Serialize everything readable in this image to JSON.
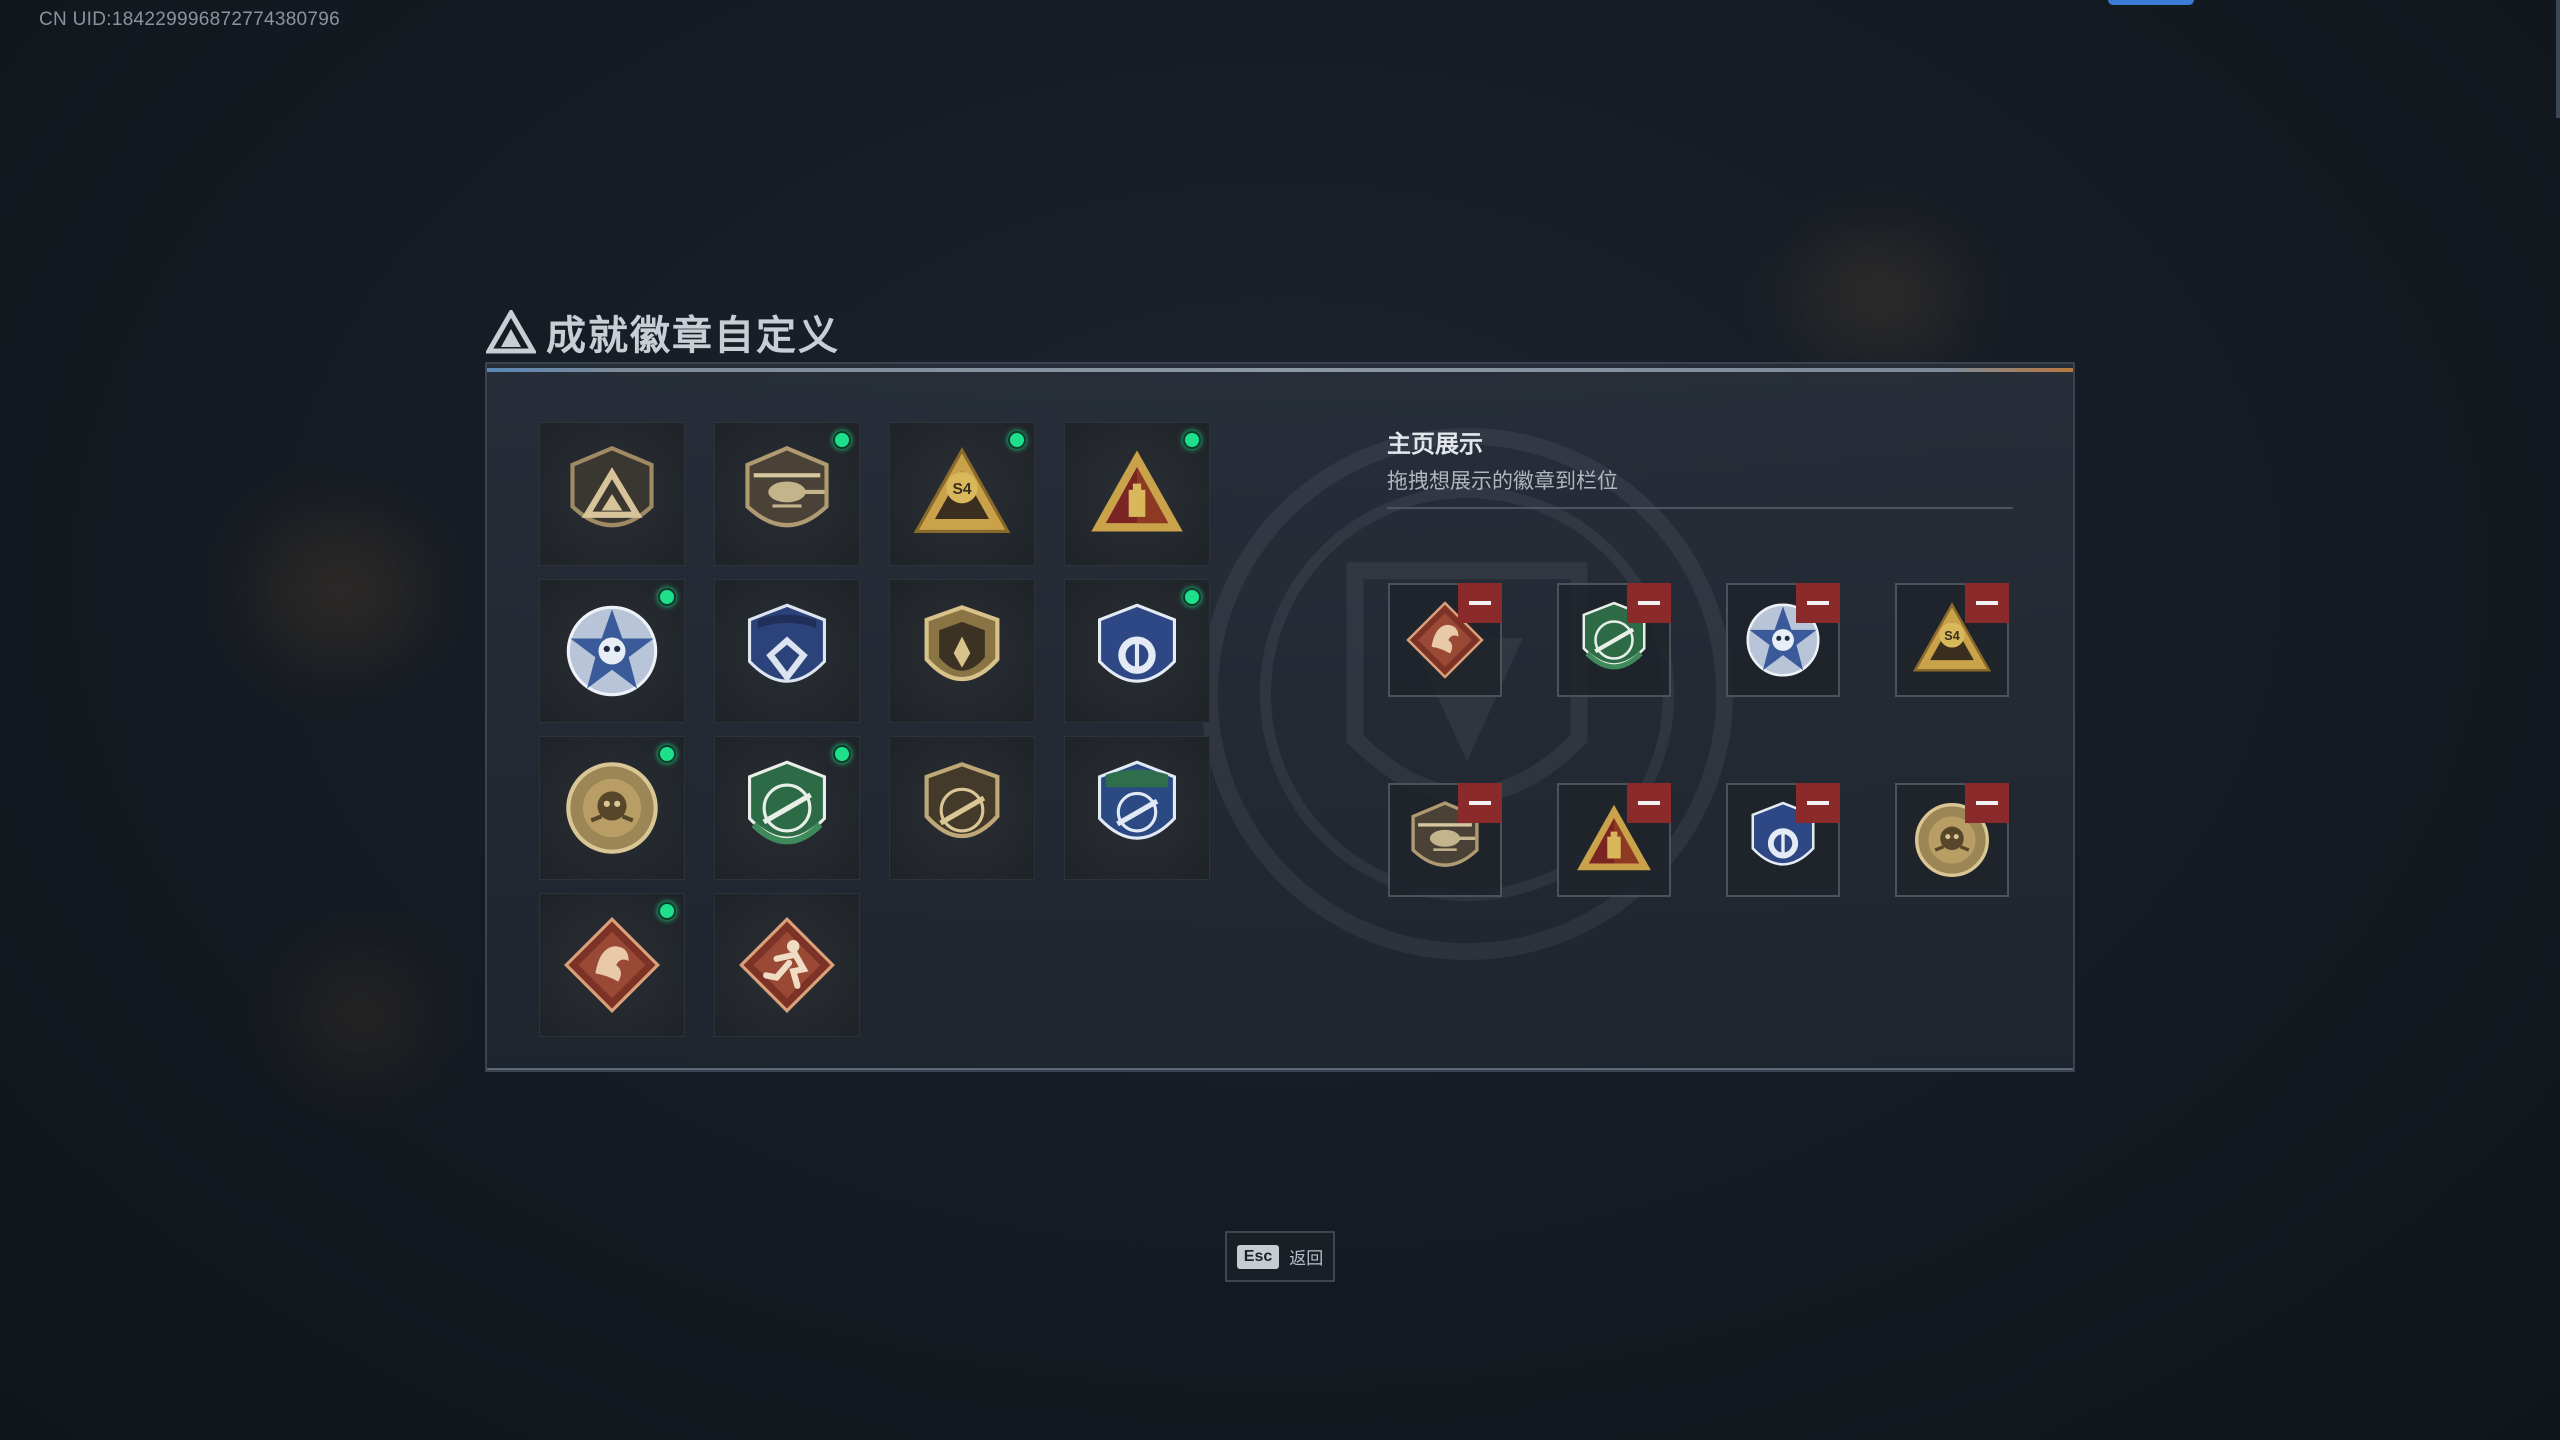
{
  "header": {
    "uid": "CN UID:1842299968727743807​96"
  },
  "dialog": {
    "title": "成就徽章自定义"
  },
  "collection": {
    "badges": [
      {
        "icon": "shield-triangle-emblem-badge",
        "new": false
      },
      {
        "icon": "helicopter-shield-badge",
        "new": true
      },
      {
        "icon": "s4-gold-triangle-badge",
        "new": true
      },
      {
        "icon": "red-gold-triangle-badge",
        "new": true
      },
      {
        "icon": "blue-star-skull-badge",
        "new": true
      },
      {
        "icon": "blue-diamond-shield-badge",
        "new": false
      },
      {
        "icon": "gold-shield-badge",
        "new": false
      },
      {
        "icon": "blue-round-shield-badge",
        "new": true
      },
      {
        "icon": "gold-skull-medallion-badge",
        "new": true
      },
      {
        "icon": "green-rifle-shield-badge",
        "new": true
      },
      {
        "icon": "gold-rifle-round-badge",
        "new": false
      },
      {
        "icon": "blue-green-rifle-shield-badge",
        "new": false
      },
      {
        "icon": "red-dragon-diamond-badge",
        "new": true
      },
      {
        "icon": "red-runner-diamond-badge",
        "new": false
      }
    ]
  },
  "showcase": {
    "title": "主页展示",
    "subtitle": "拖拽想展示的徽章到栏位",
    "slots": [
      {
        "icon": "red-dragon-diamond-badge"
      },
      {
        "icon": "green-rifle-shield-badge"
      },
      {
        "icon": "blue-star-skull-badge"
      },
      {
        "icon": "s4-gold-triangle-badge"
      },
      {
        "icon": "helicopter-shield-badge"
      },
      {
        "icon": "red-gold-triangle-badge"
      },
      {
        "icon": "blue-round-shield-badge"
      },
      {
        "icon": "gold-skull-medallion-badge"
      }
    ]
  },
  "footer": {
    "esc_key": "Esc",
    "back_label": "返回"
  },
  "colors": {
    "new_indicator": "#1ee08a",
    "remove_button": "#8a2a2a",
    "accent": "#3a7bd5"
  }
}
